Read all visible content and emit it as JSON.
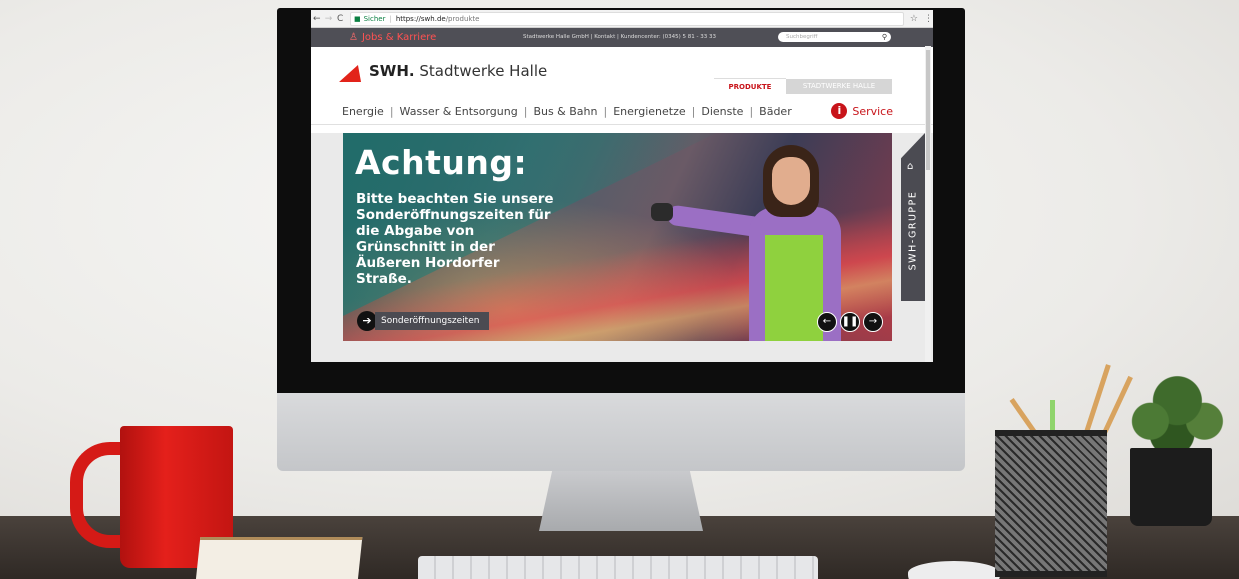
{
  "browser": {
    "back": "←",
    "forward": "→",
    "reload": "C",
    "security_label": "Sicher",
    "url_host": "https://swh.de",
    "url_path": "/produkte",
    "star": "☆",
    "menu": "⋮"
  },
  "topbar": {
    "jobs_label": "Jobs & Karriere",
    "links_text": "Stadtwerke Halle GmbH  |  Kontakt  |  Kundencenter: (0345) 5 81 - 33 33",
    "search_placeholder": "Suchbegriff"
  },
  "header": {
    "logo_bold": "SWH.",
    "logo_text": " Stadtwerke Halle",
    "tab_products": "PRODUKTE",
    "tab_company": "STADTWERKE HALLE"
  },
  "mainnav": {
    "items": [
      "Energie",
      "Wasser & Entsorgung",
      "Bus & Bahn",
      "Energienetze",
      "Dienste",
      "Bäder"
    ],
    "service_label": "Service"
  },
  "hero": {
    "title": "Achtung:",
    "body": "Bitte beachten Sie unsere Sonderöffnungszeiten für die Abgabe von Grünschnitt in der Äußeren Hordorfer Straße.",
    "cta_label": "Sonderöffnungszeiten"
  },
  "side_tab": {
    "label": "SWH-GRUPPE"
  },
  "colors": {
    "brand_red": "#e2231a",
    "topbar_gray": "#4f4f56",
    "hero_teal": "#1c7d76"
  },
  "icons": [
    "back-arrow-icon",
    "forward-arrow-icon",
    "reload-icon",
    "lock-icon",
    "star-icon",
    "menu-icon",
    "add-user-icon",
    "search-icon",
    "logo-triangle-icon",
    "info-icon",
    "arrow-right-icon",
    "arrow-left-icon",
    "pause-icon",
    "home-icon"
  ]
}
